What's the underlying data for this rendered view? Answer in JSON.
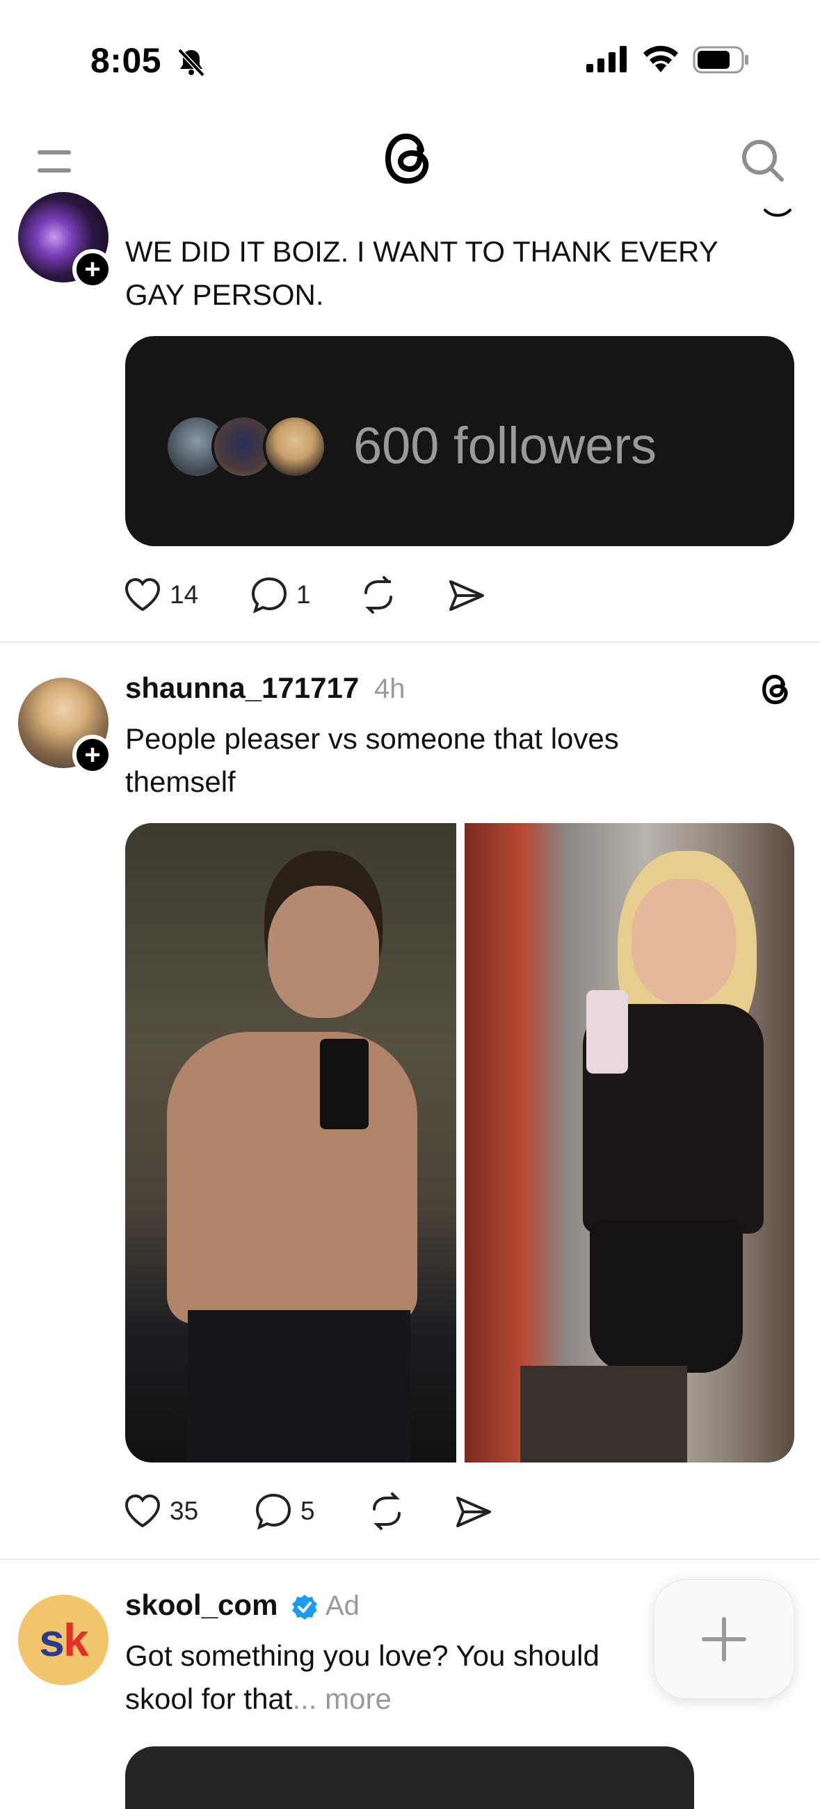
{
  "status_bar": {
    "time": "8:05"
  },
  "posts": [
    {
      "text": "WE DID IT BOIZ. I WANT TO THANK EVERY GAY PERSON.",
      "text_line1": "WE DID IT BOIZ. I WANT TO THANK EVERY",
      "text_line2": "GAY PERSON.",
      "card_text": "600 followers",
      "likes": "14",
      "replies": "1"
    },
    {
      "username": "shaunna_171717",
      "time": "4h",
      "text_line1": "People pleaser vs someone that loves",
      "text_line2": "themself",
      "likes": "35",
      "replies": "5"
    },
    {
      "username": "skool_com",
      "ad_label": "Ad",
      "text_line1": "Got something you love? You should",
      "text_line2": "skool for that",
      "ellipsis": "...",
      "more": "more",
      "avatar_text": "sk"
    }
  ],
  "colors": {
    "verified": "#1d9bf0",
    "muted": "#9a9a9a",
    "ad_avatar_bg": "#f2c46b",
    "ad_avatar_s": "#2b3a8c",
    "ad_avatar_k": "#e0312a"
  },
  "icons": [
    "bell-slash-icon",
    "signal-icon",
    "wifi-icon",
    "battery-icon",
    "menu-icon",
    "threads-logo-icon",
    "search-icon",
    "heart-icon",
    "comment-icon",
    "repost-icon",
    "share-icon",
    "plus-icon",
    "verified-icon"
  ]
}
